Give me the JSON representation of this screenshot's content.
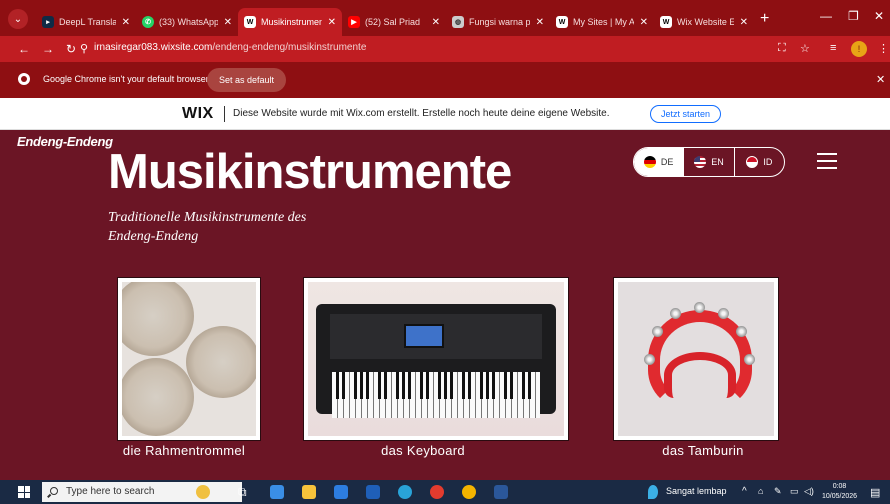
{
  "browser": {
    "tabs": [
      {
        "title": "DeepL Translate",
        "favicon": "deepl-icon",
        "color": "#0f2b46"
      },
      {
        "title": "(33) WhatsApp",
        "favicon": "whatsapp-icon",
        "color": "#25d366"
      },
      {
        "title": "Musikinstrumente",
        "favicon": "wix-icon",
        "color": "#ffffff",
        "active": true
      },
      {
        "title": "(52) Sal Priad",
        "favicon": "youtube-icon",
        "color": "#ff0000"
      },
      {
        "title": "Fungsi warna p",
        "favicon": "globe-icon",
        "color": "#cccccc"
      },
      {
        "title": "My Sites | My A",
        "favicon": "wix-icon",
        "color": "#ffffff"
      },
      {
        "title": "Wix Website Ed",
        "favicon": "wix-icon",
        "color": "#ffffff"
      }
    ],
    "url_host": "irnasiregar083.wixsite.com",
    "url_path": "/endeng-endeng/musikinstrumente",
    "profile_initial": "!"
  },
  "infobar": {
    "message": "Google Chrome isn't your default browser",
    "button": "Set as default"
  },
  "wix_banner": {
    "logo": "WIX",
    "text": "Diese Website wurde mit Wix.com erstellt. Erstelle noch heute deine eigene Website.",
    "button": "Jetzt starten"
  },
  "site": {
    "logo": "Endeng-Endeng",
    "title": "Musikinstrumente",
    "subtitle_line1": "Traditionelle Musikinstrumente des",
    "subtitle_line2": "Endeng-Endeng",
    "languages": [
      {
        "code": "DE",
        "flag": "flag-de-icon",
        "selected": true
      },
      {
        "code": "EN",
        "flag": "flag-en-icon"
      },
      {
        "code": "ID",
        "flag": "flag-id-icon"
      }
    ],
    "gallery": [
      {
        "caption": "die Rahmentrommel"
      },
      {
        "caption": "das Keyboard"
      },
      {
        "caption": "das Tamburin"
      }
    ]
  },
  "taskbar": {
    "search_placeholder": "Type here to search",
    "weather": "Sangat lembap",
    "time": "0:08",
    "date": "10/05/2026"
  },
  "colors": {
    "chrome_frame": "#8e0f12",
    "chrome_toolbar": "#c01d22",
    "site_background": "#6b1525",
    "wix_accent": "#116dff"
  }
}
